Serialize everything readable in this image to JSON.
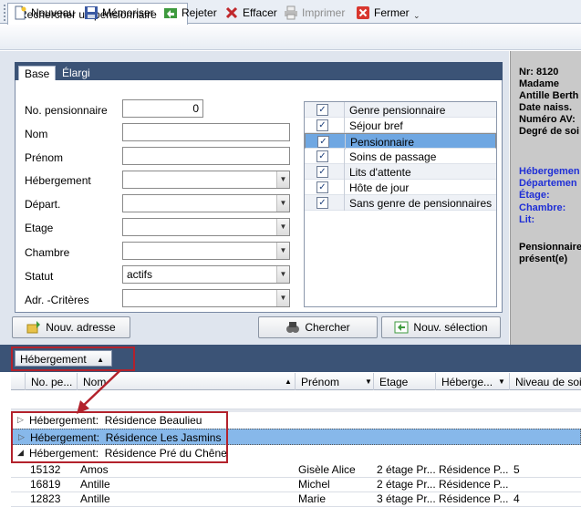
{
  "window": {
    "tab_title": "Rechercher un pensionnaire"
  },
  "toolbar": {
    "items": [
      {
        "label": "Nouveau",
        "icon": "new-document-icon",
        "enabled": true
      },
      {
        "label": "Mémoriser",
        "icon": "floppy-disk-icon",
        "enabled": true
      },
      {
        "label": "Rejeter",
        "icon": "undo-arrow-icon",
        "enabled": true
      },
      {
        "label": "Effacer",
        "icon": "red-x-icon",
        "enabled": true
      },
      {
        "label": "Imprimer",
        "icon": "printer-icon",
        "enabled": false
      },
      {
        "label": "Fermer",
        "icon": "close-box-icon",
        "enabled": true
      }
    ],
    "overflow": "⌄"
  },
  "search": {
    "tabs": {
      "active": "Base",
      "inactive": "Élargi"
    },
    "fields": {
      "no_pensionnaire": {
        "label": "No. pensionnaire",
        "value": "0"
      },
      "nom": {
        "label": "Nom",
        "value": ""
      },
      "prenom": {
        "label": "Prénom",
        "value": ""
      },
      "hebergement": {
        "label": "Hébergement",
        "value": ""
      },
      "depart": {
        "label": "Départ.",
        "value": ""
      },
      "etage": {
        "label": "Etage",
        "value": ""
      },
      "chambre": {
        "label": "Chambre",
        "value": ""
      },
      "statut": {
        "label": "Statut",
        "value": "actifs"
      },
      "adr_criteres": {
        "label": "Adr. -Critères",
        "value": ""
      }
    },
    "checklist": [
      {
        "label": "Genre pensionnaire",
        "checked": true
      },
      {
        "label": "Séjour bref",
        "checked": true
      },
      {
        "label": "Pensionnaire",
        "checked": true,
        "selected": true
      },
      {
        "label": "Soins de passage",
        "checked": true
      },
      {
        "label": "Lits d'attente",
        "checked": true
      },
      {
        "label": "Hôte de jour",
        "checked": true
      },
      {
        "label": "Sans genre de pensionnaires",
        "checked": true
      }
    ],
    "buttons": {
      "new_address": "Nouv. adresse",
      "search": "Chercher",
      "new_selection": "Nouv. sélection"
    }
  },
  "info_panel": {
    "lines": [
      "Nr: 8120",
      "Madame",
      "Antille Berth",
      "Date naiss.",
      "Numéro AV:",
      "Degré de soi"
    ],
    "blue_lines": [
      "Hébergemen",
      "Départemen",
      "Étage:",
      "Chambre:",
      "Lit:"
    ],
    "footer_lines": [
      "Pensionnaire",
      "présent(e)"
    ]
  },
  "grouping": {
    "chip_label": "Hébergement"
  },
  "grid": {
    "columns": [
      "No. pe...",
      "Nom",
      "Prénom",
      "Etage",
      "Héberge...",
      "Niveau de soin"
    ],
    "group_prefix": "Hébergement:",
    "groups": [
      {
        "name": "Résidence Beaulieu",
        "expanded": false
      },
      {
        "name": "Résidence Les Jasmins",
        "expanded": false,
        "selected": true
      },
      {
        "name": "Résidence Pré du Chêne",
        "expanded": true
      }
    ],
    "rows": [
      {
        "no": "15132",
        "nom": "Amos",
        "prenom": "Gisèle Alice",
        "etage": "2 étage Pr...",
        "hebergement": "Résidence P...",
        "niveau": "5"
      },
      {
        "no": "16819",
        "nom": "Antille",
        "prenom": "Michel",
        "etage": "2 étage Pr...",
        "hebergement": "Résidence P...",
        "niveau": ""
      },
      {
        "no": "12823",
        "nom": "Antille",
        "prenom": "Marie",
        "etage": "3 étage Pr...",
        "hebergement": "Résidence P...",
        "niveau": "4"
      }
    ]
  },
  "colors": {
    "accent_dark": "#3b5376",
    "selection": "#6fa7e2",
    "annotation_red": "#b3222c",
    "info_blue": "#1f2fd6"
  }
}
